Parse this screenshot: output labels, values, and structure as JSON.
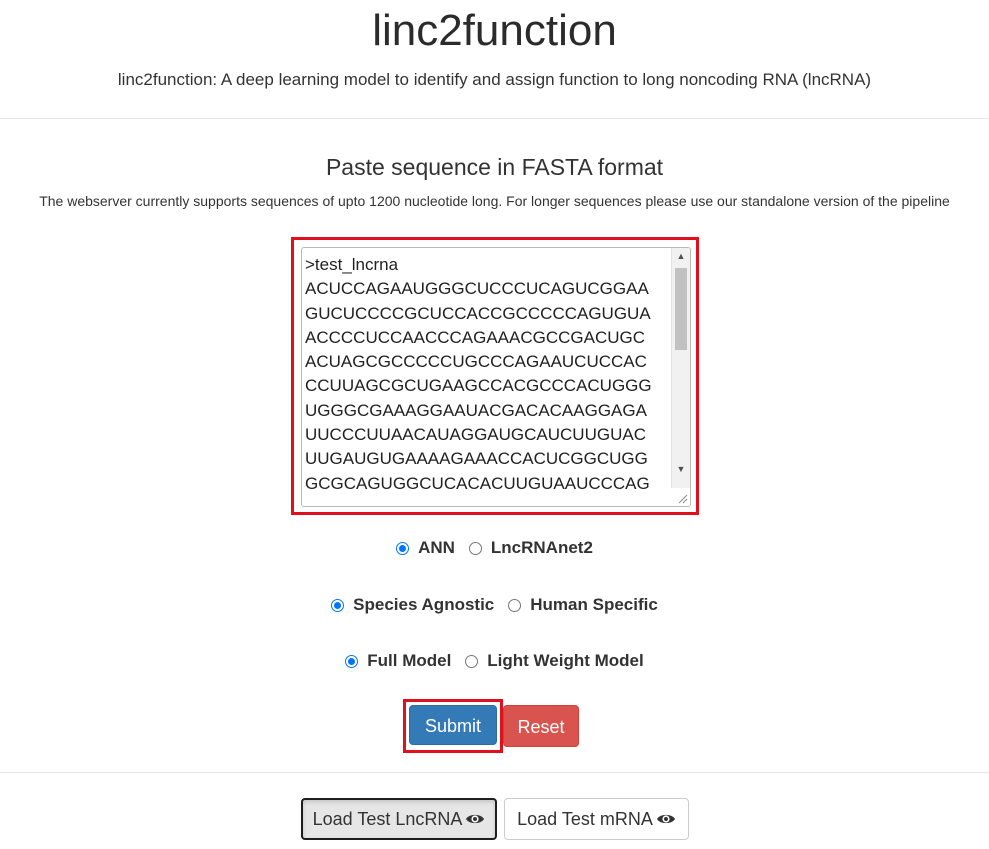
{
  "header": {
    "title": "linc2function",
    "subtitle": "linc2function: A deep learning model to identify and assign function to long noncoding RNA (lncRNA)"
  },
  "input_section": {
    "heading": "Paste sequence in FASTA format",
    "note": "The webserver currently supports sequences of upto 1200 nucleotide long. For longer sequences please use our standalone version of the pipeline",
    "sequence_text": ">test_lncrna\nACUCCAGAAUGGGCUCCCUCAGUCGGAA\nGUCUCCCCGCUCCACCGCCCCCAGUGUA\nACCCCUCCAACCCAGAAACGCCGACUGC\nACUAGCGCCCCCUGCCCAGAAUCUCCAC\nCCUUAGCGCUGAAGCCACGCCCACUGGG\nUGGGCGAAAGGAAUACGACACAAGGAGA\nUUCCCUUAACAUAGGAUGCAUCUUGUAC\nUUGAUGUGAAAAGAAACCACUCGGCUGG\nGCGCAGUGGCUCACACUUGUAAUCCCAG"
  },
  "options": {
    "model": {
      "items": [
        {
          "label": "ANN",
          "checked": true
        },
        {
          "label": "LncRNAnet2",
          "checked": false
        }
      ]
    },
    "species": {
      "items": [
        {
          "label": "Species Agnostic",
          "checked": true
        },
        {
          "label": "Human Specific",
          "checked": false
        }
      ]
    },
    "size": {
      "items": [
        {
          "label": "Full Model",
          "checked": true
        },
        {
          "label": "Light Weight Model",
          "checked": false
        }
      ]
    }
  },
  "actions": {
    "submit_label": "Submit",
    "reset_label": "Reset"
  },
  "test_buttons": {
    "lncrna_label": "Load Test LncRNA",
    "mrna_label": "Load Test mRNA"
  },
  "colors": {
    "submit": "#337ab7",
    "reset": "#d9534f",
    "highlight": "#e0101e",
    "radio_checked": "#0075ff"
  },
  "icons": {
    "load_lncrna": "eye-icon",
    "load_mrna": "eye-icon"
  }
}
